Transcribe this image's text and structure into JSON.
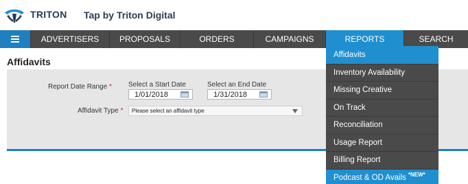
{
  "header": {
    "brand": "TRITON",
    "tagline": "Tap by Triton Digital"
  },
  "nav": {
    "items": [
      {
        "label": "ADVERTISERS"
      },
      {
        "label": "PROPOSALS"
      },
      {
        "label": "ORDERS"
      },
      {
        "label": "CAMPAIGNS"
      },
      {
        "label": "REPORTS"
      },
      {
        "label": "SEARCH"
      }
    ],
    "active": "REPORTS"
  },
  "page": {
    "title": "Affidavits"
  },
  "form": {
    "date_range_label": "Report Date Range",
    "required_marker": "*",
    "start_label": "Select a Start Date",
    "start_value": "1/01/2018",
    "end_label": "Select an End Date",
    "end_value": "1/31/2018",
    "type_label": "Affidavit Type",
    "type_placeholder": "Please select an affidavit type"
  },
  "reports_menu": {
    "items": [
      {
        "label": "Affidavits"
      },
      {
        "label": "Inventory Availability"
      },
      {
        "label": "Missing Creative"
      },
      {
        "label": "On Track"
      },
      {
        "label": "Reconciliation"
      },
      {
        "label": "Usage Report"
      },
      {
        "label": "Billing Report"
      },
      {
        "label": "Podcast & OD Avails",
        "badge": "*NEW*"
      }
    ],
    "highlighted": "Affidavits"
  },
  "colors": {
    "accent": "#1f8fd0",
    "nav_bg": "#4a4a4a",
    "panel_bg": "#e6e6e6",
    "required": "#cc2222"
  },
  "icons": [
    "triton-logo-icon",
    "hamburger-menu-icon",
    "calendar-icon",
    "dropdown-arrow-icon"
  ]
}
